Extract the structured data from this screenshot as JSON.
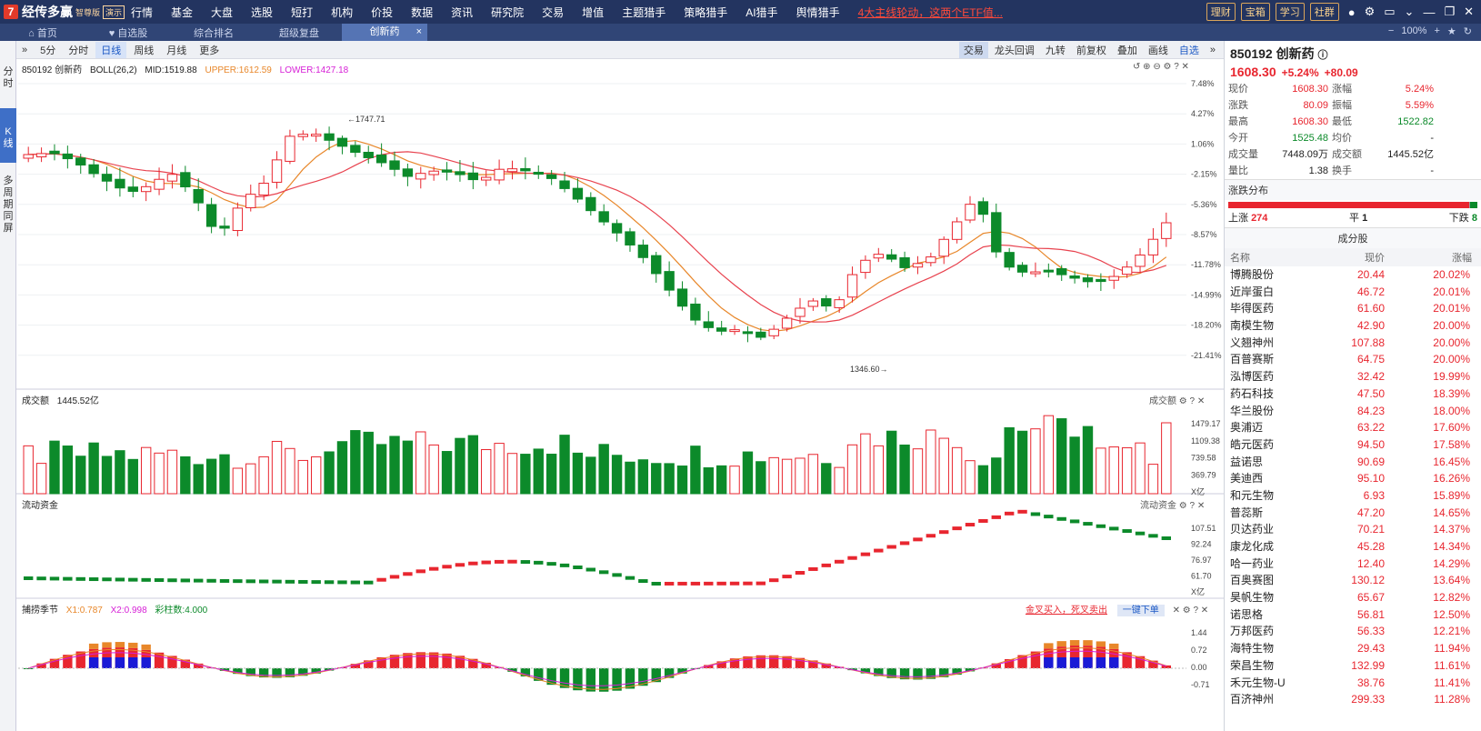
{
  "app": {
    "logo_mark": "7",
    "name": "经传多赢",
    "edition": "智尊版",
    "badge": "演示"
  },
  "menu": [
    "行情",
    "基金",
    "大盘",
    "选股",
    "短打",
    "机构",
    "价投",
    "数据",
    "资讯",
    "研究院",
    "交易",
    "增值",
    "主题猎手",
    "策略猎手",
    "AI猎手",
    "舆情猎手"
  ],
  "ticker_news": "4大主线轮动，这两个ETF值...",
  "top_buttons": [
    "理财",
    "宝箱",
    "学习",
    "社群"
  ],
  "tabs": [
    "首页",
    "自选股",
    "综合排名",
    "超级复盘",
    "创新药"
  ],
  "zoom": "100%",
  "left_rail": [
    "分时",
    "K线",
    "多周期同屏"
  ],
  "periods": [
    "5分",
    "分时",
    "日线",
    "周线",
    "月线",
    "更多"
  ],
  "chart_tools": [
    "交易",
    "龙头回调",
    "九转",
    "前复权",
    "叠加",
    "画线",
    "自选"
  ],
  "main_legend": {
    "code": "850192 创新药",
    "boll": "BOLL(26,2)",
    "mid": "MID:1519.88",
    "upper": "UPPER:1612.59",
    "lower": "LOWER:1427.18"
  },
  "price_axis": [
    "7.48%",
    "4.27%",
    "1.06%",
    "-2.15%",
    "-5.36%",
    "-8.57%",
    "-11.78%",
    "-14.99%",
    "-18.20%",
    "-21.41%"
  ],
  "high_label": "1747.71",
  "low_label": "1346.60",
  "vol_legend": {
    "name": "成交额",
    "value": "1445.52亿"
  },
  "vol_axis": [
    "1479.17",
    "1109.38",
    "739.58",
    "369.79",
    "X亿"
  ],
  "vol_tag": "成交额",
  "flow_legend": "流动资金",
  "flow_axis": [
    "107.51",
    "92.24",
    "76.97",
    "61.70",
    "X亿"
  ],
  "flow_tag": "流动资金",
  "ind_legend": {
    "name": "捕捞季节",
    "x1": "X1:0.787",
    "x2": "X2:0.998",
    "bars": "彩柱数:4.000"
  },
  "ind_axis": [
    "1.44",
    "0.72",
    "0.00",
    "-0.71"
  ],
  "ind_link": "金叉买入，死叉卖出",
  "ind_btn": "一键下单",
  "quote": {
    "code_name": "850192 创新药",
    "price": "1608.30",
    "pct": "+5.24%",
    "chg": "+80.09",
    "rows": [
      [
        "现价",
        "1608.30",
        "涨幅",
        "5.24%"
      ],
      [
        "涨跌",
        "80.09",
        "振幅",
        "5.59%"
      ],
      [
        "最高",
        "1608.30",
        "最低",
        "1522.82"
      ],
      [
        "今开",
        "1525.48",
        "均价",
        "-"
      ],
      [
        "成交量",
        "7448.09万",
        "成交额",
        "1445.52亿"
      ],
      [
        "量比",
        "1.38",
        "换手",
        "-"
      ]
    ]
  },
  "distribution": {
    "title": "涨跌分布",
    "up_label": "上涨",
    "up": "274",
    "flat_label": "平",
    "flat": "1",
    "down_label": "下跌",
    "down": "8"
  },
  "constituents": {
    "title": "成分股",
    "headers": [
      "名称",
      "现价",
      "涨幅"
    ],
    "rows": [
      [
        "博腾股份",
        "20.44",
        "20.02%"
      ],
      [
        "近岸蛋白",
        "46.72",
        "20.01%"
      ],
      [
        "毕得医药",
        "61.60",
        "20.01%"
      ],
      [
        "南模生物",
        "42.90",
        "20.00%"
      ],
      [
        "义翘神州",
        "107.88",
        "20.00%"
      ],
      [
        "百普赛斯",
        "64.75",
        "20.00%"
      ],
      [
        "泓博医药",
        "32.42",
        "19.99%"
      ],
      [
        "药石科技",
        "47.50",
        "18.39%"
      ],
      [
        "华兰股份",
        "84.23",
        "18.00%"
      ],
      [
        "奥浦迈",
        "63.22",
        "17.60%"
      ],
      [
        "皓元医药",
        "94.50",
        "17.58%"
      ],
      [
        "益诺思",
        "90.69",
        "16.45%"
      ],
      [
        "美迪西",
        "95.10",
        "16.26%"
      ],
      [
        "和元生物",
        "6.93",
        "15.89%"
      ],
      [
        "普蕊斯",
        "47.20",
        "14.65%"
      ],
      [
        "贝达药业",
        "70.21",
        "14.37%"
      ],
      [
        "康龙化成",
        "45.28",
        "14.34%"
      ],
      [
        "哈一药业",
        "12.40",
        "14.29%"
      ],
      [
        "百奥赛图",
        "130.12",
        "13.64%"
      ],
      [
        "昊帆生物",
        "65.67",
        "12.82%"
      ],
      [
        "诺思格",
        "56.81",
        "12.50%"
      ],
      [
        "万邦医药",
        "56.33",
        "12.21%"
      ],
      [
        "海特生物",
        "29.43",
        "11.94%"
      ],
      [
        "荣昌生物",
        "132.99",
        "11.61%"
      ],
      [
        "禾元生物-U",
        "38.76",
        "11.41%"
      ],
      [
        "百济神州",
        "299.33",
        "11.28%"
      ]
    ]
  },
  "chart_data": {
    "type": "candlestick",
    "series": [
      {
        "name": "K线",
        "count": 88
      },
      {
        "name": "成交额",
        "count": 88
      },
      {
        "name": "流动资金",
        "count": 88
      },
      {
        "name": "捕捞季节",
        "count": 88
      }
    ],
    "y_range": [
      -21.41,
      7.48
    ],
    "key_values": {
      "high": 1747.71,
      "low": 1346.6,
      "last": 1608.3
    }
  }
}
